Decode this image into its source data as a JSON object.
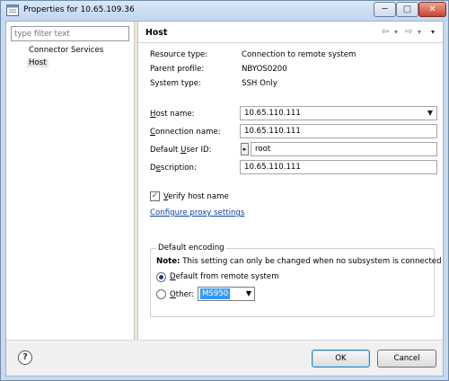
{
  "window": {
    "title": "Properties for 10.65.109.36",
    "controls": {
      "minimize": "─",
      "maximize": "□",
      "close": "✕"
    }
  },
  "filter": {
    "placeholder": "type filter text"
  },
  "tree": {
    "items": [
      {
        "label": "Connector Services",
        "selected": false
      },
      {
        "label": "Host",
        "selected": true
      }
    ]
  },
  "page": {
    "title": "Host",
    "nav": {
      "back": "⇦",
      "dropdown": "▾",
      "forward": "⇨",
      "menu": "▾"
    },
    "info": [
      {
        "label": "Resource type:",
        "value": "Connection to remote system"
      },
      {
        "label": "Parent profile:",
        "value": "NBYOS0200"
      },
      {
        "label": "System type:",
        "value": "SSH Only"
      }
    ],
    "fields": {
      "host_name": {
        "mnemonic": "H",
        "label_rest": "ost name:",
        "value": "10.65.110.111"
      },
      "connection_name": {
        "mnemonic": "C",
        "label_rest": "onnection name:",
        "value": "10.65.110.111"
      },
      "default_user_id": {
        "mnemonic": "U",
        "label_pre": "Default ",
        "label_rest": "ser ID:",
        "value": "root"
      },
      "description": {
        "mnemonic": "e",
        "label_pre": "D",
        "label_rest": "scription:",
        "value": "10.65.110.111"
      }
    },
    "verify_host": {
      "checked": true,
      "mnemonic": "V",
      "label_rest": "erify host name"
    },
    "proxy_link": "Configure proxy settings",
    "encoding": {
      "title": "Default encoding",
      "note_bold": "Note:",
      "note_text": " This setting can only be changed when no subsystem is connected",
      "default_option": {
        "mnemonic": "D",
        "label_rest": "efault from remote system",
        "selected": true
      },
      "other_option": {
        "mnemonic": "O",
        "label_rest": "ther:",
        "selected": false
      },
      "other_value": "MS950"
    }
  },
  "buttons": {
    "help": "?",
    "ok": "OK",
    "cancel": "Cancel"
  },
  "colors": {
    "title_bar": "#c8daf0",
    "link": "#0b3fa6",
    "selection": "#3399ff"
  }
}
